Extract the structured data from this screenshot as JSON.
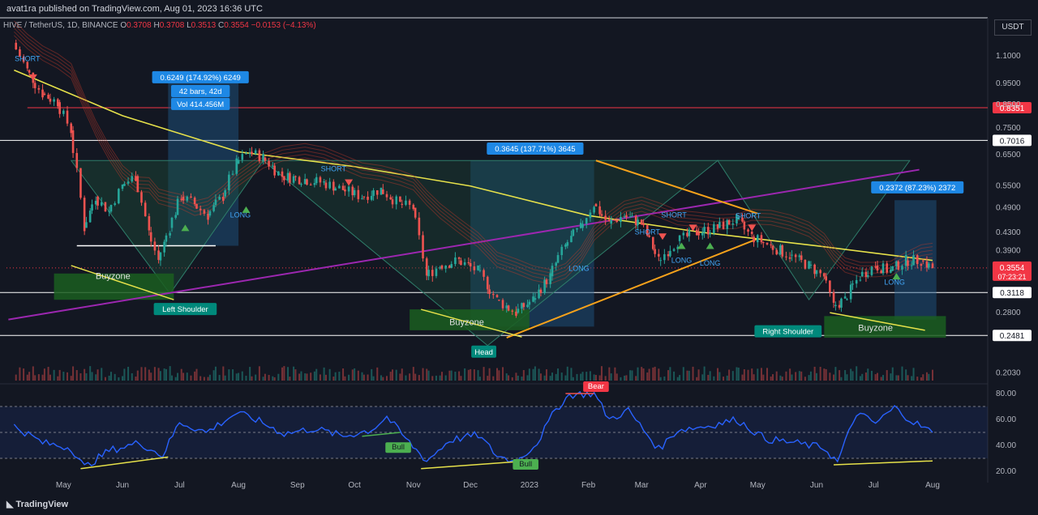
{
  "header": {
    "published": "avat1ra published on TradingView.com, Aug 01, 2023 16:36 UTC",
    "symbol": "HIVE / TetherUS, 1D, BINANCE",
    "open_label": "O",
    "open": "0.3708",
    "high_label": "H",
    "high": "0.3708",
    "low_label": "L",
    "low": "0.3513",
    "close_label": "C",
    "close": "0.3554",
    "change": "−0.0153 (−4.13%)",
    "unit": "USDT"
  },
  "footer": {
    "brand": "TradingView"
  },
  "colors": {
    "background": "#131722",
    "up": "#26a69a",
    "down": "#ef5350",
    "ma": "#e6e14a",
    "trend_orange": "#f7a21b",
    "trend_purple": "#9c27b0",
    "rsi": "#2962ff",
    "resistance": "#f23645",
    "support": "#ffffff",
    "buyzone": "#1b5e20",
    "measure": "#1e5a8c"
  },
  "chart_data": [
    {
      "type": "candlestick",
      "title": "HIVE / TetherUS, 1D, BINANCE",
      "xlabel": "",
      "ylabel": "USDT",
      "y_scale": "log",
      "ylim": [
        0.195,
        1.28
      ],
      "x_range": [
        "2022-04-01",
        "2023-08-30"
      ],
      "x_ticks": [
        {
          "label": "May",
          "date": "2022-05-01"
        },
        {
          "label": "Jun",
          "date": "2022-06-01"
        },
        {
          "label": "Jul",
          "date": "2022-07-01"
        },
        {
          "label": "Aug",
          "date": "2022-08-01"
        },
        {
          "label": "Sep",
          "date": "2022-09-01"
        },
        {
          "label": "Oct",
          "date": "2022-10-01"
        },
        {
          "label": "Nov",
          "date": "2022-11-01"
        },
        {
          "label": "Dec",
          "date": "2022-12-01"
        },
        {
          "label": "2023",
          "date": "2023-01-01"
        },
        {
          "label": "Feb",
          "date": "2023-02-01"
        },
        {
          "label": "Mar",
          "date": "2023-03-01"
        },
        {
          "label": "Apr",
          "date": "2023-04-01"
        },
        {
          "label": "May",
          "date": "2023-05-01"
        },
        {
          "label": "Jun",
          "date": "2023-06-01"
        },
        {
          "label": "Jul",
          "date": "2023-07-01"
        },
        {
          "label": "Aug",
          "date": "2023-08-01"
        }
      ],
      "y_ticks": [
        "1.1000",
        "0.9500",
        "0.8500",
        "0.7500",
        "0.6500",
        "0.5500",
        "0.4900",
        "0.4300",
        "0.3900",
        "0.2800",
        "0.2030"
      ],
      "price_levels": [
        {
          "value": 0.8351,
          "label": "0.8351",
          "color": "#f23645"
        },
        {
          "value": 0.7016,
          "label": "0.7016",
          "color": "#ffffff"
        },
        {
          "value": 0.3118,
          "label": "0.3118",
          "color": "#ffffff"
        },
        {
          "value": 0.2481,
          "label": "0.2481",
          "color": "#ffffff"
        }
      ],
      "last_price": {
        "value": 0.3554,
        "label": "0.3554",
        "countdown": "07:23:21"
      },
      "series": [
        {
          "name": "",
          "values": [
            {
              "d": "2022-04-05",
              "c": 1.18
            },
            {
              "d": "2022-04-12",
              "c": 1.02
            },
            {
              "d": "2022-04-20",
              "c": 0.9
            },
            {
              "d": "2022-04-28",
              "c": 0.86
            },
            {
              "d": "2022-05-05",
              "c": 0.74
            },
            {
              "d": "2022-05-12",
              "c": 0.44
            },
            {
              "d": "2022-05-18",
              "c": 0.52
            },
            {
              "d": "2022-05-25",
              "c": 0.48
            },
            {
              "d": "2022-06-01",
              "c": 0.55
            },
            {
              "d": "2022-06-08",
              "c": 0.58
            },
            {
              "d": "2022-06-15",
              "c": 0.43
            },
            {
              "d": "2022-06-20",
              "c": 0.37
            },
            {
              "d": "2022-06-26",
              "c": 0.44
            },
            {
              "d": "2022-07-02",
              "c": 0.52
            },
            {
              "d": "2022-07-09",
              "c": 0.5
            },
            {
              "d": "2022-07-16",
              "c": 0.47
            },
            {
              "d": "2022-07-24",
              "c": 0.52
            },
            {
              "d": "2022-07-31",
              "c": 0.62
            },
            {
              "d": "2022-08-07",
              "c": 0.66
            },
            {
              "d": "2022-08-14",
              "c": 0.64
            },
            {
              "d": "2022-08-24",
              "c": 0.58
            },
            {
              "d": "2022-09-05",
              "c": 0.57
            },
            {
              "d": "2022-09-15",
              "c": 0.56
            },
            {
              "d": "2022-09-25",
              "c": 0.54
            },
            {
              "d": "2022-10-05",
              "c": 0.52
            },
            {
              "d": "2022-10-15",
              "c": 0.54
            },
            {
              "d": "2022-10-25",
              "c": 0.5
            },
            {
              "d": "2022-11-01",
              "c": 0.49
            },
            {
              "d": "2022-11-08",
              "c": 0.34
            },
            {
              "d": "2022-11-15",
              "c": 0.36
            },
            {
              "d": "2022-11-25",
              "c": 0.37
            },
            {
              "d": "2022-12-05",
              "c": 0.35
            },
            {
              "d": "2022-12-15",
              "c": 0.3
            },
            {
              "d": "2022-12-25",
              "c": 0.28
            },
            {
              "d": "2023-01-03",
              "c": 0.3
            },
            {
              "d": "2023-01-12",
              "c": 0.34
            },
            {
              "d": "2023-01-20",
              "c": 0.4
            },
            {
              "d": "2023-01-28",
              "c": 0.44
            },
            {
              "d": "2023-02-04",
              "c": 0.5
            },
            {
              "d": "2023-02-12",
              "c": 0.45
            },
            {
              "d": "2023-02-20",
              "c": 0.47
            },
            {
              "d": "2023-03-01",
              "c": 0.45
            },
            {
              "d": "2023-03-10",
              "c": 0.37
            },
            {
              "d": "2023-03-20",
              "c": 0.41
            },
            {
              "d": "2023-03-30",
              "c": 0.43
            },
            {
              "d": "2023-04-10",
              "c": 0.44
            },
            {
              "d": "2023-04-20",
              "c": 0.46
            },
            {
              "d": "2023-04-28",
              "c": 0.42
            },
            {
              "d": "2023-05-08",
              "c": 0.4
            },
            {
              "d": "2023-05-18",
              "c": 0.38
            },
            {
              "d": "2023-05-28",
              "c": 0.36
            },
            {
              "d": "2023-06-05",
              "c": 0.34
            },
            {
              "d": "2023-06-10",
              "c": 0.29
            },
            {
              "d": "2023-06-16",
              "c": 0.3
            },
            {
              "d": "2023-06-24",
              "c": 0.34
            },
            {
              "d": "2023-07-02",
              "c": 0.36
            },
            {
              "d": "2023-07-10",
              "c": 0.35
            },
            {
              "d": "2023-07-18",
              "c": 0.37
            },
            {
              "d": "2023-07-26",
              "c": 0.37
            },
            {
              "d": "2023-08-01",
              "c": 0.3554
            }
          ]
        }
      ],
      "annotations": [
        {
          "text": "0.6249 (174.92%) 6249",
          "kind": "measure"
        },
        {
          "text": "42 bars, 42d",
          "kind": "measure"
        },
        {
          "text": "Vol 414.456M",
          "kind": "measure"
        },
        {
          "text": "0.3645 (137.71%) 3645",
          "kind": "measure"
        },
        {
          "text": "0.2372 (87.23%) 2372",
          "kind": "measure"
        },
        {
          "text": "Buyzone",
          "kind": "zone"
        },
        {
          "text": "Buyzone",
          "kind": "zone"
        },
        {
          "text": "Buyzone",
          "kind": "zone"
        },
        {
          "text": "Left Shoulder",
          "kind": "pattern"
        },
        {
          "text": "Head",
          "kind": "pattern"
        },
        {
          "text": "Right Shoulder",
          "kind": "pattern"
        },
        {
          "text": "SHORT",
          "kind": "signal"
        },
        {
          "text": "SHORT",
          "kind": "signal"
        },
        {
          "text": "SHORT",
          "kind": "signal"
        },
        {
          "text": "SHORT",
          "kind": "signal"
        },
        {
          "text": "SHORT",
          "kind": "signal"
        },
        {
          "text": "LONG",
          "kind": "signal"
        },
        {
          "text": "LONG",
          "kind": "signal"
        },
        {
          "text": "LONG",
          "kind": "signal"
        },
        {
          "text": "LONG",
          "kind": "signal"
        },
        {
          "text": "LONG",
          "kind": "signal"
        }
      ]
    },
    {
      "type": "line",
      "title": "",
      "xlabel": "",
      "ylabel": "",
      "ylim": [
        15,
        85
      ],
      "y_ticks": [
        "80.00",
        "60.00",
        "40.00",
        "20.00"
      ],
      "bands": [
        30,
        50,
        70
      ],
      "series": [
        {
          "name": "",
          "values": [
            {
              "d": "2022-04-05",
              "v": 55
            },
            {
              "d": "2022-04-20",
              "v": 42
            },
            {
              "d": "2022-05-05",
              "v": 38
            },
            {
              "d": "2022-05-12",
              "v": 23
            },
            {
              "d": "2022-05-25",
              "v": 36
            },
            {
              "d": "2022-06-10",
              "v": 42
            },
            {
              "d": "2022-06-22",
              "v": 32
            },
            {
              "d": "2022-07-01",
              "v": 58
            },
            {
              "d": "2022-07-15",
              "v": 50
            },
            {
              "d": "2022-07-31",
              "v": 65
            },
            {
              "d": "2022-08-10",
              "v": 60
            },
            {
              "d": "2022-08-25",
              "v": 49
            },
            {
              "d": "2022-09-10",
              "v": 53
            },
            {
              "d": "2022-09-25",
              "v": 47
            },
            {
              "d": "2022-10-10",
              "v": 52
            },
            {
              "d": "2022-10-18",
              "v": 62
            },
            {
              "d": "2022-10-28",
              "v": 45
            },
            {
              "d": "2022-11-08",
              "v": 28
            },
            {
              "d": "2022-11-20",
              "v": 44
            },
            {
              "d": "2022-12-05",
              "v": 48
            },
            {
              "d": "2022-12-15",
              "v": 32
            },
            {
              "d": "2022-12-25",
              "v": 27
            },
            {
              "d": "2023-01-05",
              "v": 42
            },
            {
              "d": "2023-01-15",
              "v": 68
            },
            {
              "d": "2023-01-22",
              "v": 79
            },
            {
              "d": "2023-02-04",
              "v": 80
            },
            {
              "d": "2023-02-12",
              "v": 60
            },
            {
              "d": "2023-02-22",
              "v": 67
            },
            {
              "d": "2023-03-10",
              "v": 37
            },
            {
              "d": "2023-03-20",
              "v": 52
            },
            {
              "d": "2023-04-05",
              "v": 55
            },
            {
              "d": "2023-04-20",
              "v": 60
            },
            {
              "d": "2023-05-05",
              "v": 45
            },
            {
              "d": "2023-05-20",
              "v": 42
            },
            {
              "d": "2023-06-05",
              "v": 38
            },
            {
              "d": "2023-06-12",
              "v": 27
            },
            {
              "d": "2023-06-22",
              "v": 65
            },
            {
              "d": "2023-07-02",
              "v": 57
            },
            {
              "d": "2023-07-12",
              "v": 69
            },
            {
              "d": "2023-07-22",
              "v": 58
            },
            {
              "d": "2023-08-01",
              "v": 50
            }
          ]
        }
      ],
      "annotations": [
        {
          "text": "Bull",
          "kind": "divergence"
        },
        {
          "text": "Bull",
          "kind": "divergence"
        },
        {
          "text": "Bear",
          "kind": "divergence"
        }
      ]
    }
  ]
}
